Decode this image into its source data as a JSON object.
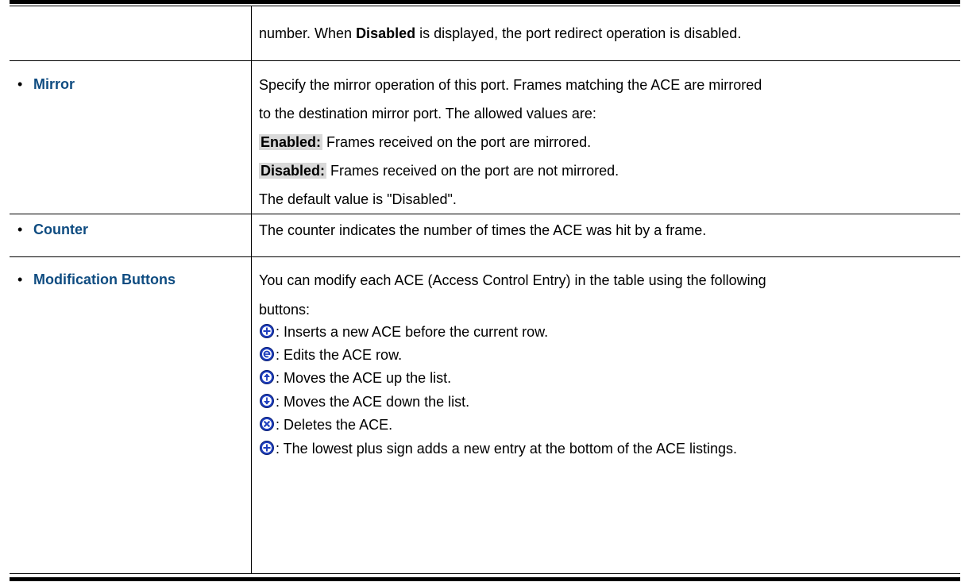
{
  "row0": {
    "prefix": "number. When ",
    "bold": "Disabled",
    "suffix": " is displayed, the port redirect operation is disabled."
  },
  "mirror": {
    "bullet": "•",
    "label": "Mirror",
    "line1": "Specify the mirror operation of this port. Frames matching the ACE are mirrored",
    "line2": "to the destination mirror port. The allowed values are:",
    "enabled_label": "Enabled:",
    "enabled_text": " Frames received on the port are mirrored.",
    "disabled_label": "Disabled:",
    "disabled_text": " Frames received on the port are not mirrored.",
    "default_text": "The default value is \"Disabled\"."
  },
  "counter": {
    "bullet": "•",
    "label": "Counter",
    "text": "The counter indicates the number of times the ACE was hit by a frame."
  },
  "modification": {
    "bullet": "•",
    "label": "Modification Buttons",
    "line1": "You can modify each ACE (Access Control Entry) in the table using the following",
    "line2": "buttons:",
    "items": [
      {
        "icon": "plus-circle-icon",
        "text": ": Inserts a new ACE before the current row."
      },
      {
        "icon": "edit-circle-icon",
        "text": ": Edits the ACE row."
      },
      {
        "icon": "arrow-up-circle-icon",
        "text": ": Moves the ACE up the list."
      },
      {
        "icon": "arrow-down-circle-icon",
        "text": ": Moves the ACE down the list."
      },
      {
        "icon": "delete-circle-icon",
        "text": ": Deletes the ACE."
      },
      {
        "icon": "plus-circle-icon",
        "text": ": The lowest plus sign adds a new entry at the bottom of the ACE listings."
      }
    ]
  },
  "colors": {
    "label": "#0f4c81",
    "icon_fill": "#1f3fbf",
    "highlight": "#d9d9d9"
  }
}
